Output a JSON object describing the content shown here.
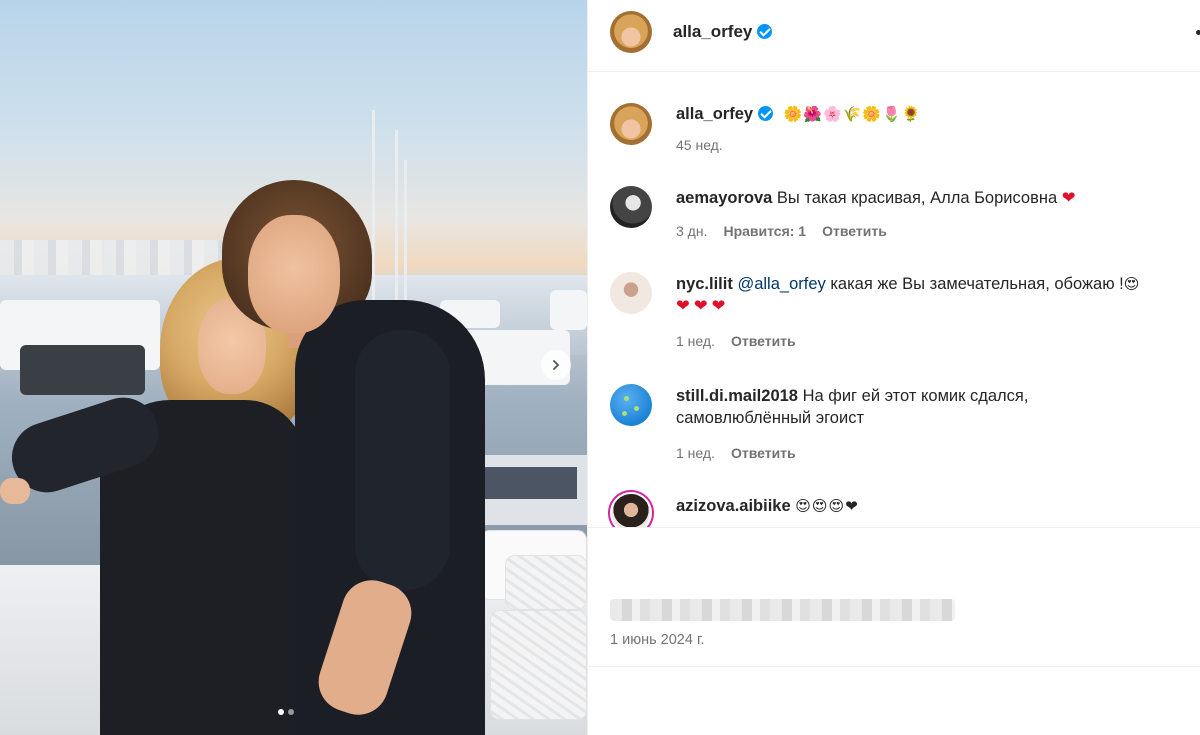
{
  "post": {
    "author": "alla_orfey",
    "caption": "🌼🌺🌸🌾🌼🌷🌻",
    "caption_time": "45 нед.",
    "date": "1 июнь 2024 г.",
    "slides_total": 2,
    "slide_active": 1
  },
  "comments": [
    {
      "user": "aemayorova",
      "text": "Вы такая красивая, Алла Борисовна",
      "emoji": "❤",
      "time": "3 дн.",
      "likes": "Нравится: 1",
      "reply": "Ответить"
    },
    {
      "user": "nyc.lilit",
      "mention": "@alla_orfey",
      "text": "какая же Вы замечательная, обожаю !",
      "emoji": "😍",
      "emoji_line2": "❤❤❤",
      "time": "1 нед.",
      "reply": "Ответить"
    },
    {
      "user": "still.di.mail2018",
      "text": "На фиг ей этот комик сдался, самовлюблённый эгоист",
      "time": "1 нед.",
      "reply": "Ответить"
    },
    {
      "user": "azizova.aibiike",
      "emoji": "😍😍😍❤"
    }
  ],
  "icons": [
    "verified-badge-icon",
    "chevron-right-icon",
    "more-options-icon"
  ],
  "colors": {
    "verified": "#0095f6",
    "meta": "#737373",
    "heart": "#e0102b",
    "story_ring": "#d6249f"
  }
}
